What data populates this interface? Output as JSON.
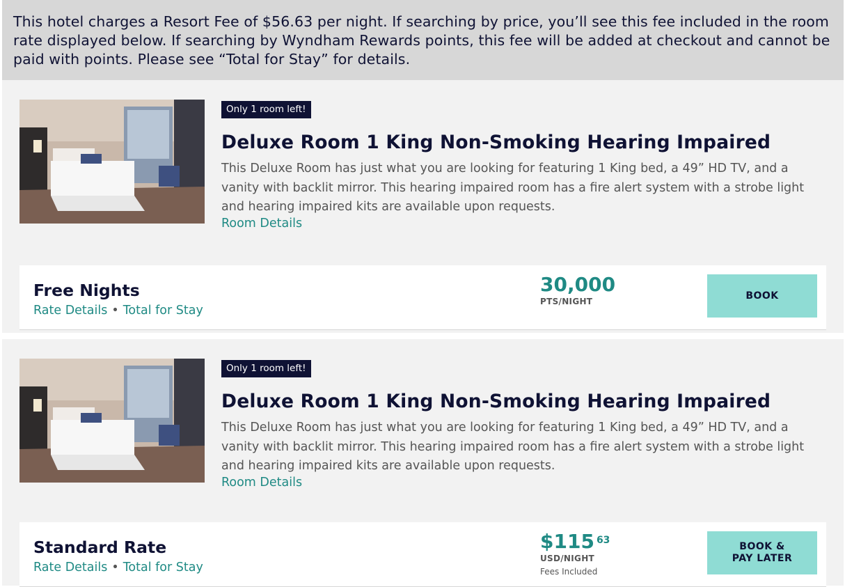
{
  "notice": {
    "text": "This hotel charges a Resort Fee of $56.63 per night. If searching by price, you’ll see this fee included in the room rate displayed below. If searching by Wyndham Rewards points, this fee will be added at checkout and cannot be paid with points. Please see “Total for Stay” for details."
  },
  "rooms": [
    {
      "badge": "Only 1 room left!",
      "title": "Deluxe Room 1 King Non-Smoking Hearing Impaired",
      "description": "This Deluxe Room has just what you are looking for featuring 1 King bed, a 49” HD TV, and a vanity with backlit mirror. This hearing impaired room has a fire alert system with a strobe light and hearing impaired kits are available upon requests.",
      "details_link": "Room Details",
      "rate": {
        "name": "Free Nights",
        "rate_details": "Rate Details",
        "separator": "•",
        "total_for_stay": "Total for Stay",
        "price": "30,000",
        "price_unit": "PTS/NIGHT",
        "book_label": "BOOK"
      }
    },
    {
      "badge": "Only 1 room left!",
      "title": "Deluxe Room 1 King Non-Smoking Hearing Impaired",
      "description": "This Deluxe Room has just what you are looking for featuring 1 King bed, a 49” HD TV, and a vanity with backlit mirror. This hearing impaired room has a fire alert system with a strobe light and hearing impaired kits are available upon requests.",
      "details_link": "Room Details",
      "rate": {
        "name": "Standard Rate",
        "rate_details": "Rate Details",
        "separator": "•",
        "total_for_stay": "Total for Stay",
        "price": "$115",
        "price_cents": "63",
        "price_unit": "USD/NIGHT",
        "price_note": "Fees Included",
        "book_label": "BOOK &\nPAY LATER"
      }
    }
  ],
  "colors": {
    "navy": "#0f1234",
    "teal": "#1f8a84",
    "button": "#8fdcd4",
    "notice_bg": "#d7d7d7",
    "card_bg": "#f2f2f2"
  }
}
